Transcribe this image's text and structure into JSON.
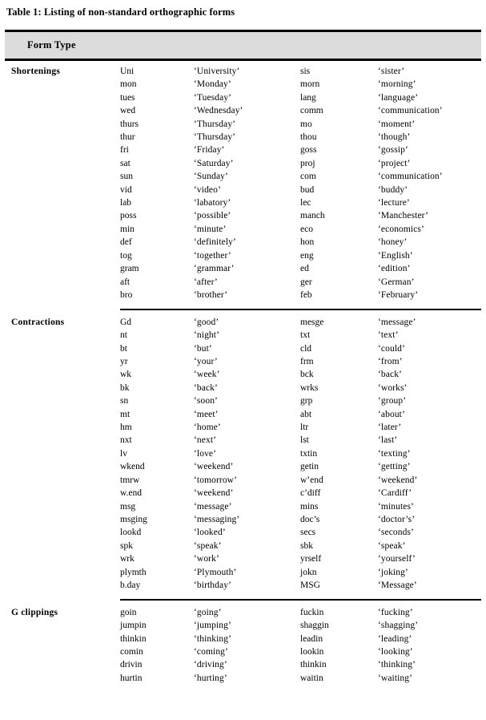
{
  "caption": "Table 1: Listing of non-standard orthographic forms",
  "header": {
    "column_label": "Form Type"
  },
  "sections": [
    {
      "label": "Shortenings",
      "rows": [
        {
          "form_a": "Uni",
          "gloss_a": "‘University’",
          "form_b": "sis",
          "gloss_b": "‘sister’"
        },
        {
          "form_a": "mon",
          "gloss_a": "‘Monday’",
          "form_b": "morn",
          "gloss_b": "‘morning’"
        },
        {
          "form_a": "tues",
          "gloss_a": "‘Tuesday’",
          "form_b": "lang",
          "gloss_b": "‘language’"
        },
        {
          "form_a": "wed",
          "gloss_a": "‘Wednesday’",
          "form_b": "comm",
          "gloss_b": "‘communication’"
        },
        {
          "form_a": "thurs",
          "gloss_a": "‘Thursday’",
          "form_b": "mo",
          "gloss_b": "‘moment’"
        },
        {
          "form_a": "thur",
          "gloss_a": "‘Thursday’",
          "form_b": "thou",
          "gloss_b": "‘though’"
        },
        {
          "form_a": "fri",
          "gloss_a": "‘Friday’",
          "form_b": "goss",
          "gloss_b": "‘gossip’"
        },
        {
          "form_a": "sat",
          "gloss_a": "‘Saturday’",
          "form_b": "proj",
          "gloss_b": "‘project’"
        },
        {
          "form_a": "sun",
          "gloss_a": "‘Sunday’",
          "form_b": "com",
          "gloss_b": "‘communication’"
        },
        {
          "form_a": "vid",
          "gloss_a": "‘video’",
          "form_b": "bud",
          "gloss_b": "‘buddy’"
        },
        {
          "form_a": "lab",
          "gloss_a": "‘labatory’",
          "form_b": "lec",
          "gloss_b": "‘lecture’"
        },
        {
          "form_a": "poss",
          "gloss_a": "‘possible’",
          "form_b": "manch",
          "gloss_b": "‘Manchester’"
        },
        {
          "form_a": "min",
          "gloss_a": "‘minute’",
          "form_b": "eco",
          "gloss_b": "‘economics’"
        },
        {
          "form_a": "def",
          "gloss_a": "‘definitely’",
          "form_b": "hon",
          "gloss_b": "‘honey’"
        },
        {
          "form_a": "tog",
          "gloss_a": "‘together’",
          "form_b": "eng",
          "gloss_b": "‘English’"
        },
        {
          "form_a": "gram",
          "gloss_a": "‘grammar’",
          "form_b": "ed",
          "gloss_b": "‘edition’"
        },
        {
          "form_a": "aft",
          "gloss_a": "‘after’",
          "form_b": "ger",
          "gloss_b": "‘German’"
        },
        {
          "form_a": "bro",
          "gloss_a": "‘brother’",
          "form_b": "feb",
          "gloss_b": "‘February’"
        }
      ]
    },
    {
      "label": "Contractions",
      "rows": [
        {
          "form_a": "Gd",
          "gloss_a": "‘good’",
          "form_b": "mesge",
          "gloss_b": "‘message’"
        },
        {
          "form_a": "nt",
          "gloss_a": "‘night’",
          "form_b": "txt",
          "gloss_b": "‘text’"
        },
        {
          "form_a": "bt",
          "gloss_a": "‘but’",
          "form_b": "cld",
          "gloss_b": "‘could’"
        },
        {
          "form_a": "yr",
          "gloss_a": "‘your’",
          "form_b": "frm",
          "gloss_b": "‘from’"
        },
        {
          "form_a": "wk",
          "gloss_a": "‘week’",
          "form_b": "bck",
          "gloss_b": "‘back’"
        },
        {
          "form_a": "bk",
          "gloss_a": "‘back’",
          "form_b": "wrks",
          "gloss_b": "‘works’"
        },
        {
          "form_a": "sn",
          "gloss_a": "‘soon’",
          "form_b": "grp",
          "gloss_b": "‘group’"
        },
        {
          "form_a": "mt",
          "gloss_a": "‘meet’",
          "form_b": "abt",
          "gloss_b": "‘about’"
        },
        {
          "form_a": "hm",
          "gloss_a": "‘home’",
          "form_b": "ltr",
          "gloss_b": "‘later’"
        },
        {
          "form_a": "nxt",
          "gloss_a": "‘next’",
          "form_b": "lst",
          "gloss_b": "‘last’"
        },
        {
          "form_a": "lv",
          "gloss_a": "‘love’",
          "form_b": "txtin",
          "gloss_b": "‘texting’"
        },
        {
          "form_a": "wkend",
          "gloss_a": "‘weekend’",
          "form_b": "getin",
          "gloss_b": "‘getting’"
        },
        {
          "form_a": "tmrw",
          "gloss_a": "‘tomorrow’",
          "form_b": "w’end",
          "gloss_b": "‘weekend’"
        },
        {
          "form_a": "w.end",
          "gloss_a": "‘weekend’",
          "form_b": "c’diff",
          "gloss_b": "‘Cardiff’"
        },
        {
          "form_a": "msg",
          "gloss_a": "‘message’",
          "form_b": "mins",
          "gloss_b": "‘minutes’"
        },
        {
          "form_a": "msging",
          "gloss_a": "‘messaging’",
          "form_b": "doc’s",
          "gloss_b": "‘doctor’s’"
        },
        {
          "form_a": "lookd",
          "gloss_a": "‘looked’",
          "form_b": "secs",
          "gloss_b": "‘seconds’"
        },
        {
          "form_a": "spk",
          "gloss_a": "‘speak’",
          "form_b": "sbk",
          "gloss_b": "‘speak’"
        },
        {
          "form_a": "wrk",
          "gloss_a": "‘work’",
          "form_b": "yrself",
          "gloss_b": "‘yourself’"
        },
        {
          "form_a": "plymth",
          "gloss_a": "‘Plymouth’",
          "form_b": "jokn",
          "gloss_b": "‘joking’"
        },
        {
          "form_a": "b.day",
          "gloss_a": "‘birthday’",
          "form_b": "MSG",
          "gloss_b": "‘Message’"
        }
      ]
    },
    {
      "label": "G clippings",
      "rows": [
        {
          "form_a": "goin",
          "gloss_a": "‘going’",
          "form_b": "fuckin",
          "gloss_b": "‘fucking’"
        },
        {
          "form_a": "jumpin",
          "gloss_a": "‘jumping’",
          "form_b": "shaggin",
          "gloss_b": "‘shagging’"
        },
        {
          "form_a": "thinkin",
          "gloss_a": "‘thinking’",
          "form_b": "leadin",
          "gloss_b": "‘leading’"
        },
        {
          "form_a": "comin",
          "gloss_a": "‘coming’",
          "form_b": "lookin",
          "gloss_b": "‘looking’"
        },
        {
          "form_a": "drivin",
          "gloss_a": "‘driving’",
          "form_b": "thinkin",
          "gloss_b": "‘thinking’"
        },
        {
          "form_a": "hurtin",
          "gloss_a": "‘hurting’",
          "form_b": "waitin",
          "gloss_b": "‘waiting’"
        }
      ]
    }
  ],
  "colors": {
    "header_band": "#dcdcdc",
    "rule": "#000000",
    "text": "#000000",
    "background": "#ffffff"
  }
}
